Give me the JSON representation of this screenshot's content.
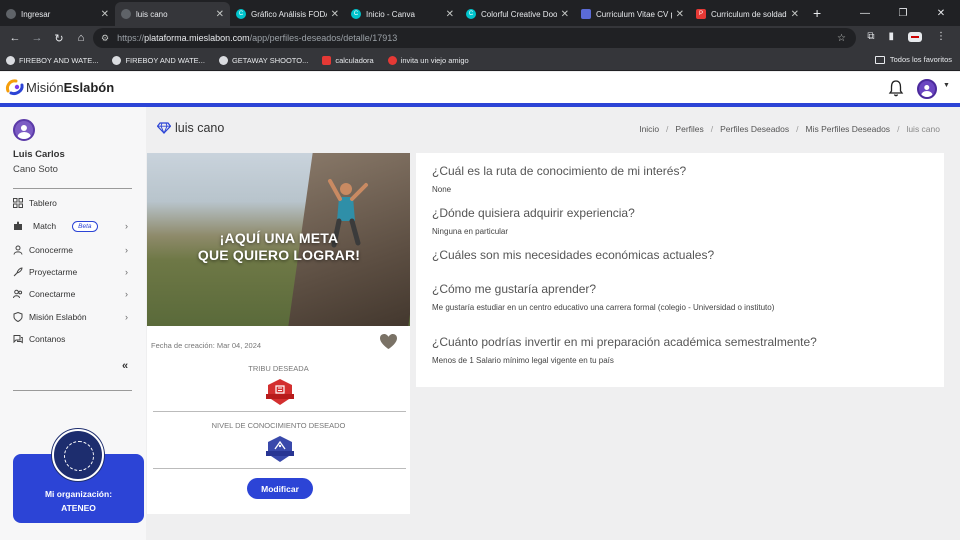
{
  "browser": {
    "tabs": [
      {
        "title": "Ingresar",
        "active": false,
        "color": "#e8eaed"
      },
      {
        "title": "luis cano",
        "active": true,
        "color": "#e8eaed"
      },
      {
        "title": "Gráfico Análisis FODA",
        "active": false,
        "color": "#00c4cc"
      },
      {
        "title": "Inicio - Canva",
        "active": false,
        "color": "#00c4cc"
      },
      {
        "title": "Colorful Creative Doo",
        "active": false,
        "color": "#00c4cc"
      },
      {
        "title": "Curriculum Vitae CV p",
        "active": false,
        "color": "#5b6bd6"
      },
      {
        "title": "Curriculum de soldad",
        "active": false,
        "color": "#e53935"
      }
    ],
    "url_scheme": "https://",
    "url_host": "plataforma.mieslabon.com",
    "url_path": "/app/perfiles-deseados/detalle/17913",
    "bookmarks": [
      "FIREBOY AND WATE...",
      "FIREBOY AND WATE...",
      "GETAWAY SHOOTO...",
      "calculadora",
      "invita un viejo amigo"
    ],
    "all_bookmarks": "Todos los favoritos"
  },
  "app": {
    "logo_part1": "Misión",
    "logo_part2": "Eslabón",
    "brand_color": "#2c44d6"
  },
  "sidebar": {
    "first_name": "Luis Carlos",
    "last_name": "Cano Soto",
    "items": [
      {
        "label": "Tablero",
        "icon": "grid-icon",
        "chevron": false
      },
      {
        "label": "Match",
        "icon": "puzzle-icon",
        "chevron": true,
        "badge": "Beta"
      },
      {
        "label": "Conocerme",
        "icon": "person-icon",
        "chevron": true
      },
      {
        "label": "Proyectarme",
        "icon": "rocket-icon",
        "chevron": true
      },
      {
        "label": "Conectarme",
        "icon": "users-icon",
        "chevron": true
      },
      {
        "label": "Misión Eslabón",
        "icon": "shield-icon",
        "chevron": true
      },
      {
        "label": "Contanos",
        "icon": "chat-icon",
        "chevron": false
      }
    ],
    "collapse_glyph": "«",
    "org_label": "Mi organización:",
    "org_name": "ATENEO"
  },
  "main": {
    "title": "luis cano",
    "breadcrumb": [
      "Inicio",
      "Perfiles",
      "Perfiles Deseados",
      "Mis Perfiles Deseados",
      "luis cano"
    ],
    "card": {
      "hero_text_line1": "¡AQUÍ UNA META",
      "hero_text_line2": "QUE QUIERO LOGRAR!",
      "created_label": "Fecha de creación: Mar 04, 2024",
      "tribe_label": "TRIBU DESEADA",
      "level_label": "NIVEL DE CONOCIMIENTO DESEADO",
      "modify_button": "Modificar"
    },
    "qa": [
      {
        "q": "¿Cuál es la ruta de conocimiento de mi interés?",
        "a": "None"
      },
      {
        "q": "¿Dónde quisiera adquirir experiencia?",
        "a": "Ninguna en particular"
      },
      {
        "q": "¿Cuáles son mis necesidades económicas actuales?",
        "a": ""
      },
      {
        "q": "¿Cómo me gustaría aprender?",
        "a": "Me gustaría estudiar en un centro educativo una carrera formal (colegio - Universidad o instituto)"
      },
      {
        "q": "¿Cuánto podrías invertir en mi preparación académica semestralmente?",
        "a": "Menos de 1 Salario mínimo legal vigente en tu país"
      }
    ]
  }
}
